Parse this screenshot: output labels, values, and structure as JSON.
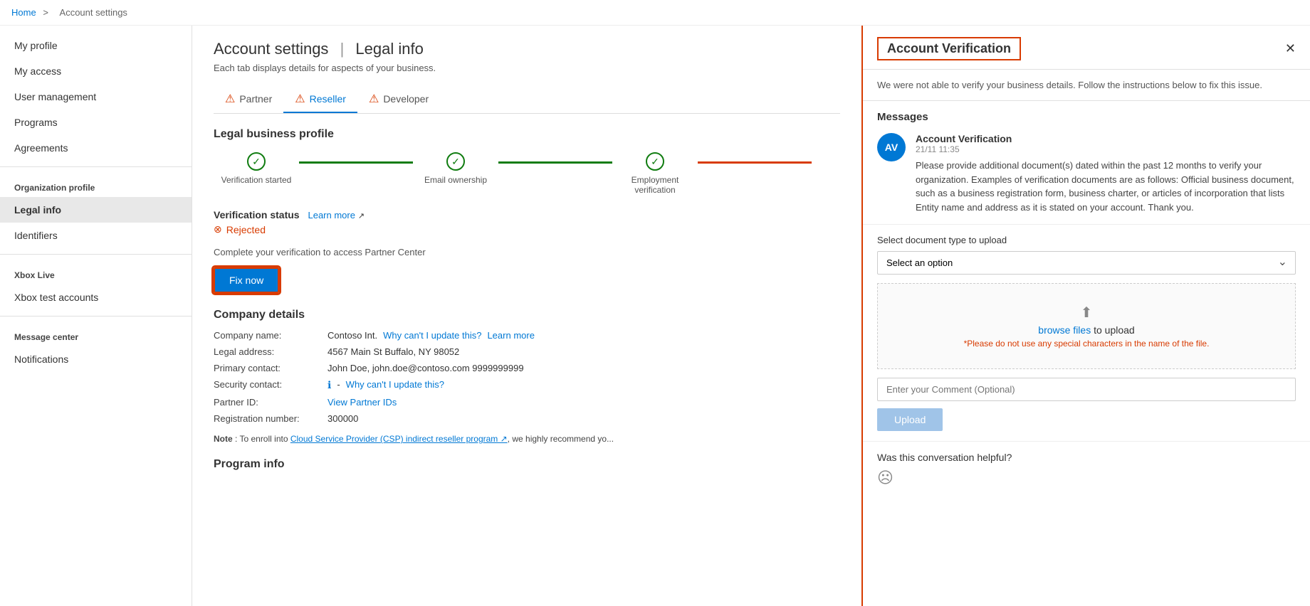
{
  "breadcrumb": {
    "home": "Home",
    "separator": ">",
    "current": "Account settings"
  },
  "sidebar": {
    "items": [
      {
        "id": "my-profile",
        "label": "My profile",
        "active": false
      },
      {
        "id": "my-access",
        "label": "My access",
        "active": false
      },
      {
        "id": "user-management",
        "label": "User management",
        "active": false
      },
      {
        "id": "programs",
        "label": "Programs",
        "active": false
      },
      {
        "id": "agreements",
        "label": "Agreements",
        "active": false
      }
    ],
    "sections": [
      {
        "label": "Organization profile",
        "items": [
          {
            "id": "legal-info",
            "label": "Legal info",
            "active": true
          },
          {
            "id": "identifiers",
            "label": "Identifiers",
            "active": false
          }
        ]
      },
      {
        "label": "Xbox Live",
        "items": [
          {
            "id": "xbox-test-accounts",
            "label": "Xbox test accounts",
            "active": false
          }
        ]
      },
      {
        "label": "Message center",
        "items": [
          {
            "id": "notifications",
            "label": "Notifications",
            "active": false
          }
        ]
      }
    ]
  },
  "main": {
    "page_title": "Account settings",
    "page_title_section": "Legal info",
    "subtitle": "Each tab displays details for aspects of your business.",
    "tabs": [
      {
        "id": "partner",
        "label": "Partner",
        "warn": true,
        "active": false
      },
      {
        "id": "reseller",
        "label": "Reseller",
        "warn": true,
        "active": true
      },
      {
        "id": "developer",
        "label": "Developer",
        "warn": true,
        "active": false
      }
    ],
    "legal_profile": {
      "title": "Legal business profile",
      "steps": [
        {
          "label": "Verification started",
          "status": "green"
        },
        {
          "label": "Email ownership",
          "status": "green"
        },
        {
          "label": "Employment verification",
          "status": "green"
        }
      ],
      "verification_status_label": "Verification status",
      "learn_more": "Learn more",
      "status": "Rejected",
      "complete_notice": "Complete your verification to access Partner Center",
      "fix_now_label": "Fix now"
    },
    "company_details": {
      "title": "Company details",
      "fields": [
        {
          "label": "Company name:",
          "value": "Contoso Int.",
          "link1": "Why can't I update this?",
          "link2": "Learn more"
        },
        {
          "label": "Legal address:",
          "value": "4567 Main St Buffalo, NY 98052"
        },
        {
          "label": "Primary contact:",
          "value": "John Doe,   john.doe@contoso.com   9999999999"
        },
        {
          "label": "Security contact:",
          "value": "-",
          "link1": "Why can't I update this?",
          "has_info": true
        },
        {
          "label": "Partner ID:",
          "value": "",
          "link1": "View Partner IDs"
        },
        {
          "label": "Registration number:",
          "value": "300000"
        }
      ]
    },
    "note": "Note : To enroll into Cloud Service Provider (CSP) indirect reseller program, we highly recommend yo...",
    "program_info_title": "Program info"
  },
  "panel": {
    "title": "Account Verification",
    "close_label": "✕",
    "description": "We were not able to verify your business details. Follow the instructions below to fix this issue.",
    "messages_title": "Messages",
    "message": {
      "avatar": "AV",
      "sender": "Account Verification",
      "time": "21/11 11:35",
      "text": "Please provide additional document(s) dated within the past 12 months to verify your organization. Examples of verification documents are as follows: Official business document, such as a business registration form, business charter, or articles of incorporation that lists Entity name and address as it is stated on your account. Thank you."
    },
    "upload": {
      "select_label": "Select document type to upload",
      "select_placeholder": "Select an option",
      "file_upload_text": "browse files",
      "file_upload_prefix": " to upload",
      "file_upload_icon": "⬆",
      "file_note": "*Please do not use any special characters in the name of the file.",
      "comment_placeholder": "Enter your Comment (Optional)",
      "upload_btn_label": "Upload"
    },
    "helpful": {
      "title": "Was this conversation helpful?",
      "icon_sad": "☹"
    }
  }
}
